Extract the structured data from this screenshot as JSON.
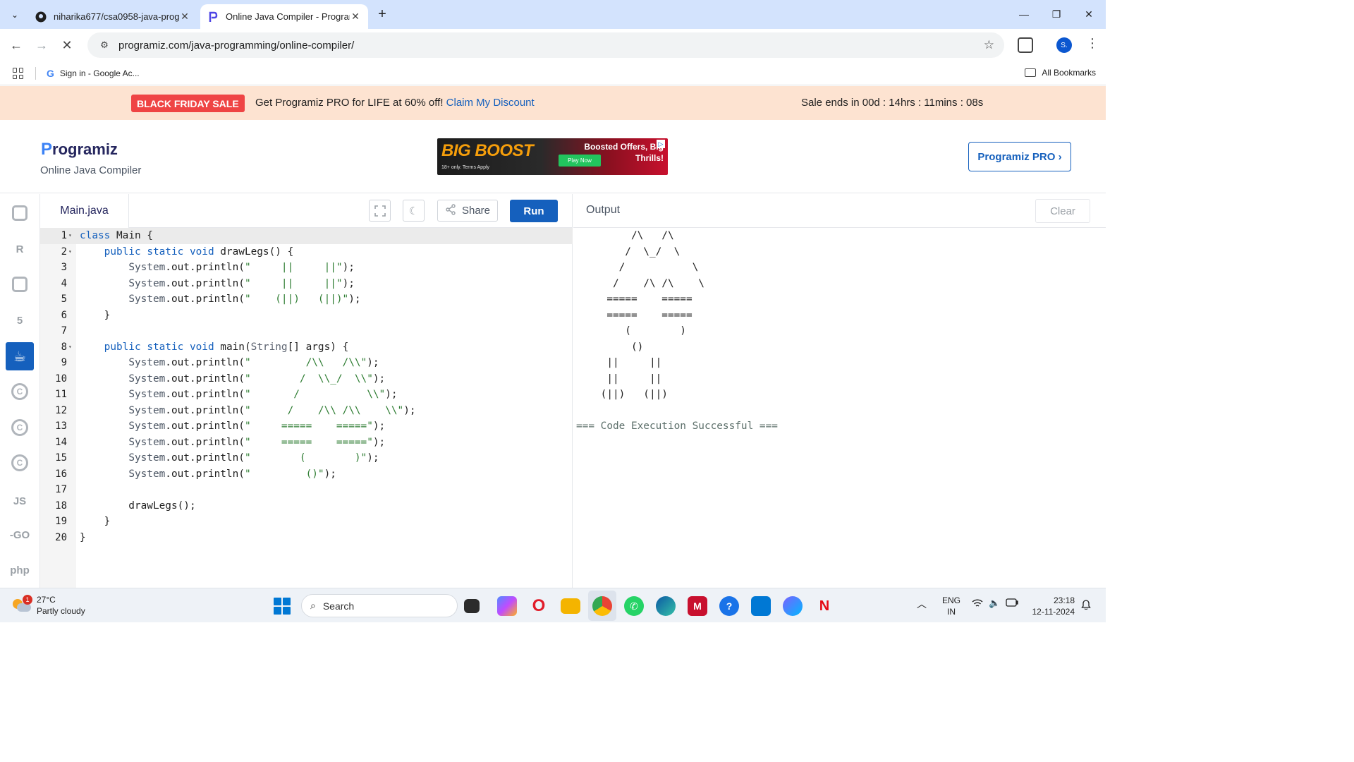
{
  "browser": {
    "tabs": [
      {
        "title": "niharika677/csa0958-java-prog",
        "icon": "github-icon"
      },
      {
        "title": "Online Java Compiler - Program",
        "icon": "programiz-icon"
      }
    ],
    "url": "programiz.com/java-programming/online-compiler/",
    "profile_initial": "S.",
    "bookmarks": [
      {
        "label": "Sign in - Google Ac..."
      }
    ],
    "all_bookmarks_label": "All Bookmarks"
  },
  "promo": {
    "badge": "BLACK FRIDAY SALE",
    "text": "Get Programiz PRO for LIFE at 60% off!",
    "link": "Claim My Discount",
    "countdown": "Sale ends in 00d : 14hrs : 11mins : 08s"
  },
  "header": {
    "logo_p": "P",
    "logo_rest": "rogramiz",
    "subtitle": "Online Java Compiler",
    "pro_button": "Programiz PRO ›",
    "ad": {
      "title": "BIG BOOST",
      "tagline1": "Boosted Offers, Big",
      "tagline2": "Thrills!",
      "cta": "Play Now",
      "small": "18+ only. Terms Apply"
    }
  },
  "sidebar": {
    "languages": [
      {
        "name": "python",
        "label": ""
      },
      {
        "name": "r",
        "label": "R"
      },
      {
        "name": "sql",
        "label": ""
      },
      {
        "name": "html",
        "label": "5"
      },
      {
        "name": "java",
        "label": "☕"
      },
      {
        "name": "c",
        "label": "C"
      },
      {
        "name": "cpp",
        "label": "C"
      },
      {
        "name": "csharp",
        "label": "C"
      },
      {
        "name": "js",
        "label": "JS"
      },
      {
        "name": "go",
        "label": "-GO"
      },
      {
        "name": "php",
        "label": "php"
      }
    ],
    "active": "java"
  },
  "editor": {
    "filename": "Main.java",
    "share_label": "Share",
    "run_label": "Run",
    "code_lines": [
      "class Main {",
      "    public static void drawLegs() {",
      "        System.out.println(\"     ||     ||\");",
      "        System.out.println(\"     ||     ||\");",
      "        System.out.println(\"    (||)   (||)\");",
      "    }",
      "",
      "    public static void main(String[] args) {",
      "        System.out.println(\"         /\\\\   /\\\\\");",
      "        System.out.println(\"        /  \\\\_/  \\\\\");",
      "        System.out.println(\"       /           \\\\\");",
      "        System.out.println(\"      /    /\\\\ /\\\\    \\\\\");",
      "        System.out.println(\"     =====    =====\");",
      "        System.out.println(\"     =====    =====\");",
      "        System.out.println(\"        (        )\");",
      "        System.out.println(\"         ()\");",
      "",
      "        drawLegs();",
      "    }",
      "}"
    ]
  },
  "output": {
    "title": "Output",
    "clear_label": "Clear",
    "lines": [
      "         /\\   /\\",
      "        /  \\_/  \\",
      "       /           \\",
      "      /    /\\ /\\    \\",
      "     =====    =====",
      "     =====    =====",
      "        (        )",
      "         ()",
      "     ||     ||",
      "     ||     ||",
      "    (||)   (||)",
      "",
      "=== Code Execution Successful ==="
    ]
  },
  "taskbar": {
    "weather_temp": "27°C",
    "weather_desc": "Partly cloudy",
    "weather_badge": "1",
    "search_placeholder": "Search",
    "lang_top": "ENG",
    "lang_bottom": "IN",
    "time": "23:18",
    "date": "12-11-2024"
  },
  "colors": {
    "brand_blue": "#1560bd",
    "promo_bg": "#fde3d1",
    "sale_red": "#ef4444",
    "tabstrip": "#d3e3fd"
  }
}
